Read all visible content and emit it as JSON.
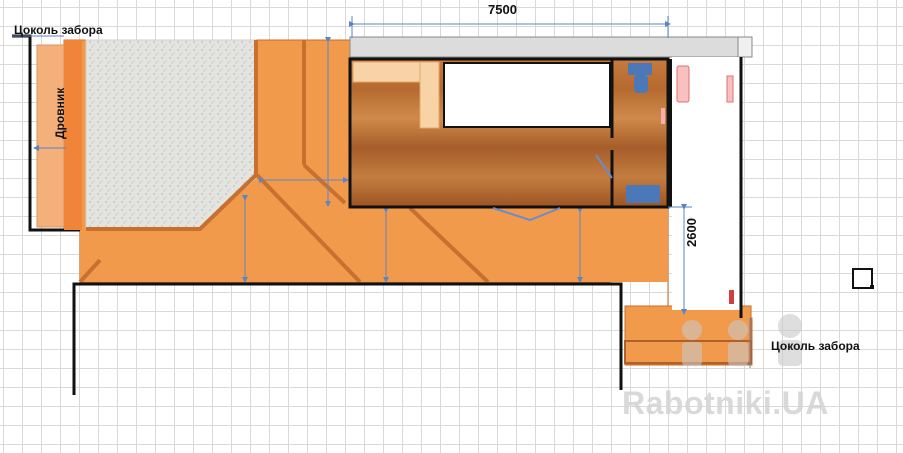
{
  "labels": {
    "fence_left": "Цоколь забора",
    "fence_right": "Цоколь забора",
    "woodshed": "Дровник",
    "dim_width": "7500",
    "dim_side": "2600"
  },
  "watermark": "Rabotniki.UA",
  "colors": {
    "paving": "#f29a4b",
    "paving_edge": "#c86d2a",
    "gravel": "#dcdcd8",
    "roof_bar": "#d9d9d9",
    "wall": "#111111",
    "furniture_blue": "#4a78b8",
    "dimension_line": "#5a86c4"
  }
}
